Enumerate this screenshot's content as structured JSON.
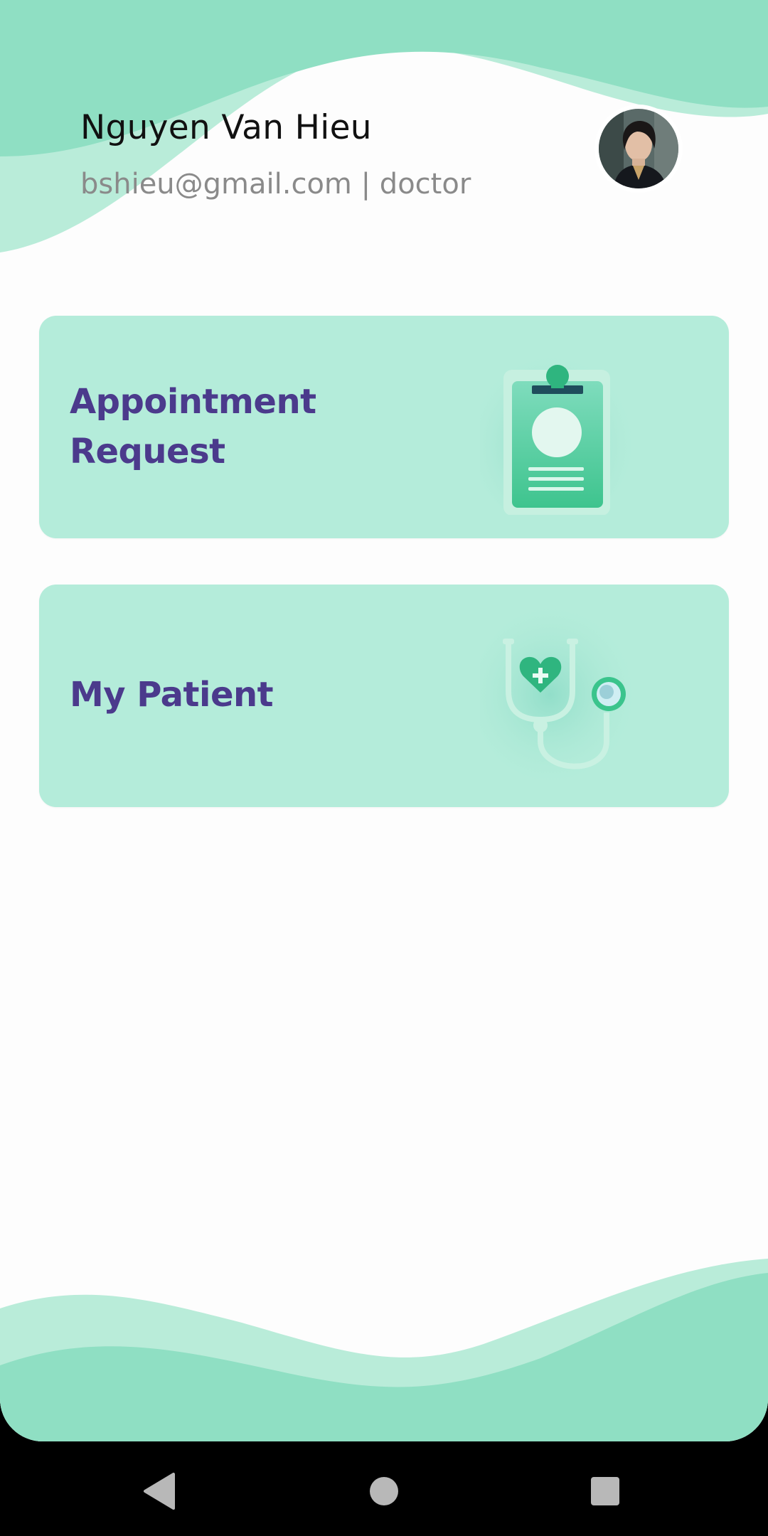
{
  "profile": {
    "name": "Nguyen Van Hieu",
    "subtitle": "bshieu@gmail.com | doctor"
  },
  "cards": [
    {
      "label_line1": "Appointment",
      "label_line2": "Request",
      "icon": "clipboard-icon"
    },
    {
      "label": "My Patient",
      "icon": "stethoscope-icon"
    }
  ],
  "nav": {
    "back_icon": "back-triangle-icon",
    "home_icon": "home-circle-icon",
    "recents_icon": "recents-square-icon"
  },
  "colors": {
    "wave_dark": "#8fdfc3",
    "wave_light": "#b9ecd9",
    "card_bg": "#b4ecda",
    "label_purple": "#4b3a8c",
    "accent_green": "#3ac48c"
  }
}
